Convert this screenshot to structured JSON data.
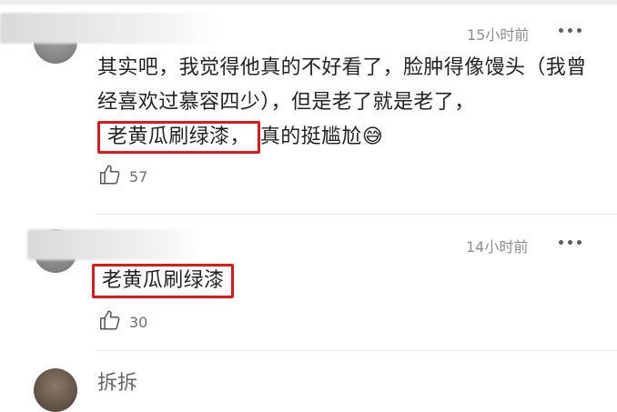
{
  "comments": [
    {
      "timestamp": "15小时前",
      "text_before": "其实吧，我觉得他真的不好看了，脸肿得像馒头（我曾经喜欢过慕容四少），但是老了就是老了，",
      "highlight": "老黄瓜刷绿漆，",
      "text_after": "真的挺尴尬",
      "emoji": "😅",
      "likes": "57"
    },
    {
      "timestamp": "14小时前",
      "highlight": "老黄瓜刷绿漆",
      "likes": "30"
    }
  ],
  "third_comment": {
    "name_partial": "拆拆"
  },
  "colors": {
    "highlight_border": "#e5161a",
    "meta_text": "#8e8e8e"
  }
}
